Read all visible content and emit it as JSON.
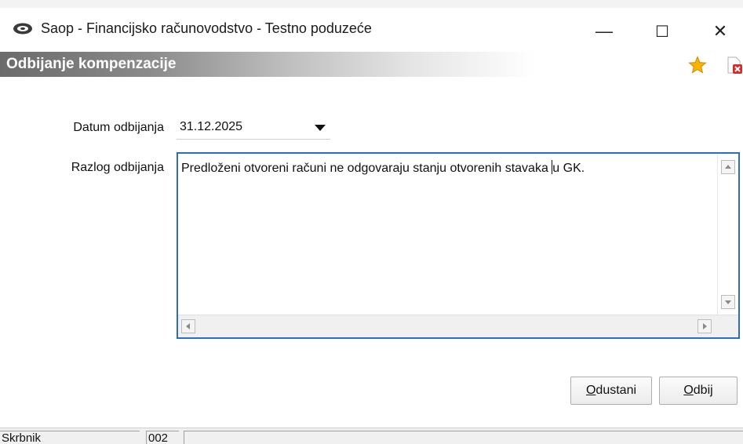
{
  "window": {
    "title": "Saop  - Financijsko računovodstvo  - Testno poduzeće",
    "minimize_symbol": "—",
    "maximize_symbol": "☐",
    "close_symbol": "✕"
  },
  "header": {
    "title": "Odbijanje kompenzacije",
    "icons": [
      "star-icon",
      "close-document-icon"
    ]
  },
  "form": {
    "date_label": "Datum odbijanja",
    "date_value": "31.12.2025",
    "reason_label": "Razlog odbijanja",
    "reason_text_before_caret": "Predloženi otvoreni računi ne odgovaraju stanju otvorenih stavaka ",
    "reason_text_after_caret": "u GK."
  },
  "buttons": {
    "cancel_mnemonic": "O",
    "cancel_rest": "dustani",
    "reject_mnemonic": "O",
    "reject_rest": "dbij"
  },
  "statusbar": {
    "user": "Skrbnik",
    "code": "002",
    "info": ""
  },
  "colors": {
    "focus_border": "#2b6cc4",
    "header_gradient_start": "#6b6b6b",
    "star": "#f5b400",
    "doc_close": "#d62b2b"
  }
}
